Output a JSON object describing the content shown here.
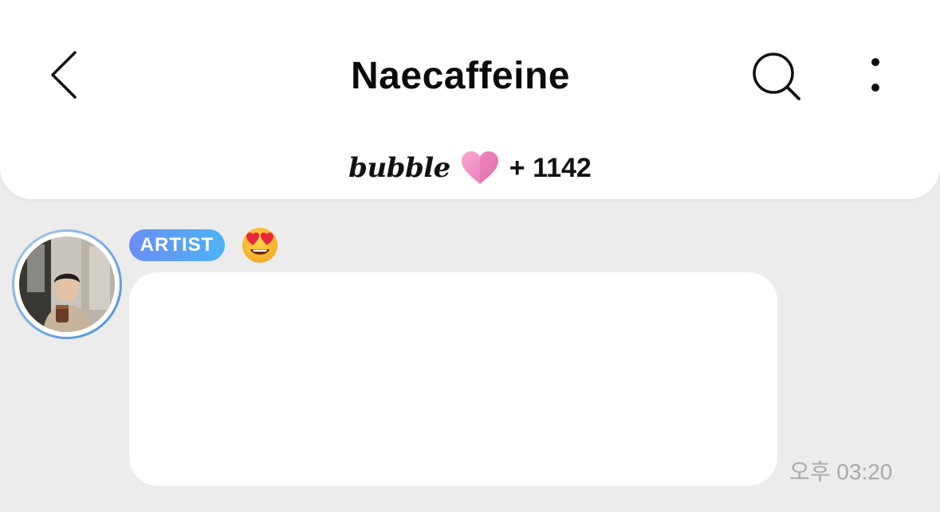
{
  "header": {
    "title": "Naecaffeine",
    "back_icon": "chevron-left-icon",
    "search_icon": "search-icon",
    "more_icon": "more-vertical-icon"
  },
  "subscription": {
    "brand": "bubble",
    "heart_icon": "heart-icon",
    "count_text": "+ 1142"
  },
  "message": {
    "sender_badge": "ARTIST",
    "reaction": "😍",
    "time": "오후 03:20"
  },
  "colors": {
    "background": "#ececec",
    "header_bg": "#ffffff",
    "badge_gradient_start": "#6b8df5",
    "badge_gradient_end": "#4db3f5",
    "heart_pink": "#f08cc0",
    "timestamp_gray": "#a9a9a9"
  }
}
